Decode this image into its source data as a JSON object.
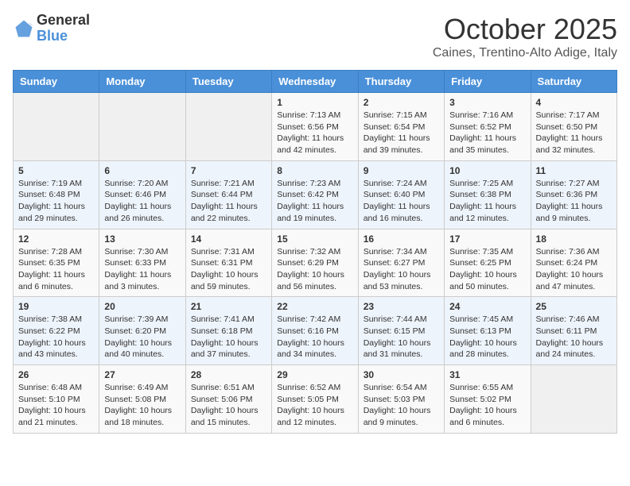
{
  "header": {
    "logo_general": "General",
    "logo_blue": "Blue",
    "month_title": "October 2025",
    "location": "Caines, Trentino-Alto Adige, Italy"
  },
  "days_of_week": [
    "Sunday",
    "Monday",
    "Tuesday",
    "Wednesday",
    "Thursday",
    "Friday",
    "Saturday"
  ],
  "weeks": [
    [
      {
        "day": "",
        "info": ""
      },
      {
        "day": "",
        "info": ""
      },
      {
        "day": "",
        "info": ""
      },
      {
        "day": "1",
        "info": "Sunrise: 7:13 AM\nSunset: 6:56 PM\nDaylight: 11 hours and 42 minutes."
      },
      {
        "day": "2",
        "info": "Sunrise: 7:15 AM\nSunset: 6:54 PM\nDaylight: 11 hours and 39 minutes."
      },
      {
        "day": "3",
        "info": "Sunrise: 7:16 AM\nSunset: 6:52 PM\nDaylight: 11 hours and 35 minutes."
      },
      {
        "day": "4",
        "info": "Sunrise: 7:17 AM\nSunset: 6:50 PM\nDaylight: 11 hours and 32 minutes."
      }
    ],
    [
      {
        "day": "5",
        "info": "Sunrise: 7:19 AM\nSunset: 6:48 PM\nDaylight: 11 hours and 29 minutes."
      },
      {
        "day": "6",
        "info": "Sunrise: 7:20 AM\nSunset: 6:46 PM\nDaylight: 11 hours and 26 minutes."
      },
      {
        "day": "7",
        "info": "Sunrise: 7:21 AM\nSunset: 6:44 PM\nDaylight: 11 hours and 22 minutes."
      },
      {
        "day": "8",
        "info": "Sunrise: 7:23 AM\nSunset: 6:42 PM\nDaylight: 11 hours and 19 minutes."
      },
      {
        "day": "9",
        "info": "Sunrise: 7:24 AM\nSunset: 6:40 PM\nDaylight: 11 hours and 16 minutes."
      },
      {
        "day": "10",
        "info": "Sunrise: 7:25 AM\nSunset: 6:38 PM\nDaylight: 11 hours and 12 minutes."
      },
      {
        "day": "11",
        "info": "Sunrise: 7:27 AM\nSunset: 6:36 PM\nDaylight: 11 hours and 9 minutes."
      }
    ],
    [
      {
        "day": "12",
        "info": "Sunrise: 7:28 AM\nSunset: 6:35 PM\nDaylight: 11 hours and 6 minutes."
      },
      {
        "day": "13",
        "info": "Sunrise: 7:30 AM\nSunset: 6:33 PM\nDaylight: 11 hours and 3 minutes."
      },
      {
        "day": "14",
        "info": "Sunrise: 7:31 AM\nSunset: 6:31 PM\nDaylight: 10 hours and 59 minutes."
      },
      {
        "day": "15",
        "info": "Sunrise: 7:32 AM\nSunset: 6:29 PM\nDaylight: 10 hours and 56 minutes."
      },
      {
        "day": "16",
        "info": "Sunrise: 7:34 AM\nSunset: 6:27 PM\nDaylight: 10 hours and 53 minutes."
      },
      {
        "day": "17",
        "info": "Sunrise: 7:35 AM\nSunset: 6:25 PM\nDaylight: 10 hours and 50 minutes."
      },
      {
        "day": "18",
        "info": "Sunrise: 7:36 AM\nSunset: 6:24 PM\nDaylight: 10 hours and 47 minutes."
      }
    ],
    [
      {
        "day": "19",
        "info": "Sunrise: 7:38 AM\nSunset: 6:22 PM\nDaylight: 10 hours and 43 minutes."
      },
      {
        "day": "20",
        "info": "Sunrise: 7:39 AM\nSunset: 6:20 PM\nDaylight: 10 hours and 40 minutes."
      },
      {
        "day": "21",
        "info": "Sunrise: 7:41 AM\nSunset: 6:18 PM\nDaylight: 10 hours and 37 minutes."
      },
      {
        "day": "22",
        "info": "Sunrise: 7:42 AM\nSunset: 6:16 PM\nDaylight: 10 hours and 34 minutes."
      },
      {
        "day": "23",
        "info": "Sunrise: 7:44 AM\nSunset: 6:15 PM\nDaylight: 10 hours and 31 minutes."
      },
      {
        "day": "24",
        "info": "Sunrise: 7:45 AM\nSunset: 6:13 PM\nDaylight: 10 hours and 28 minutes."
      },
      {
        "day": "25",
        "info": "Sunrise: 7:46 AM\nSunset: 6:11 PM\nDaylight: 10 hours and 24 minutes."
      }
    ],
    [
      {
        "day": "26",
        "info": "Sunrise: 6:48 AM\nSunset: 5:10 PM\nDaylight: 10 hours and 21 minutes."
      },
      {
        "day": "27",
        "info": "Sunrise: 6:49 AM\nSunset: 5:08 PM\nDaylight: 10 hours and 18 minutes."
      },
      {
        "day": "28",
        "info": "Sunrise: 6:51 AM\nSunset: 5:06 PM\nDaylight: 10 hours and 15 minutes."
      },
      {
        "day": "29",
        "info": "Sunrise: 6:52 AM\nSunset: 5:05 PM\nDaylight: 10 hours and 12 minutes."
      },
      {
        "day": "30",
        "info": "Sunrise: 6:54 AM\nSunset: 5:03 PM\nDaylight: 10 hours and 9 minutes."
      },
      {
        "day": "31",
        "info": "Sunrise: 6:55 AM\nSunset: 5:02 PM\nDaylight: 10 hours and 6 minutes."
      },
      {
        "day": "",
        "info": ""
      }
    ]
  ]
}
